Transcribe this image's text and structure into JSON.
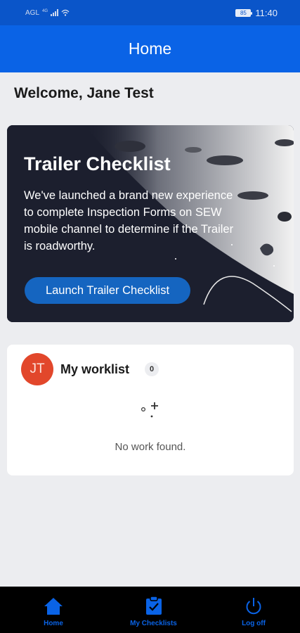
{
  "status_bar": {
    "carrier": "AGL",
    "network": "4G",
    "battery": "85",
    "time": "11:40",
    "icons": [
      "signal-icon",
      "wifi-icon",
      "battery-icon"
    ]
  },
  "app_bar": {
    "title": "Home"
  },
  "welcome": {
    "text": "Welcome, Jane Test"
  },
  "banner": {
    "title": "Trailer Checklist",
    "description": "We've launched a brand new experience to complete Inspection Forms on SEW mobile channel to determine if the Trailer is roadworthy.",
    "button_label": "Launch Trailer Checklist"
  },
  "worklist": {
    "avatar_initials": "JT",
    "title": "My worklist",
    "count": "0",
    "empty_message": "No work found.",
    "empty_icon": "sparkle-icon"
  },
  "bottom_nav": {
    "items": [
      {
        "label": "Home",
        "icon": "home-icon"
      },
      {
        "label": "My Checklists",
        "icon": "clipboard-icon"
      },
      {
        "label": "Log off",
        "icon": "power-icon"
      }
    ]
  },
  "colors": {
    "primary": "#0a63e6",
    "status_bar": "#0a55c9",
    "avatar": "#e2472b",
    "button": "#1565c0",
    "background": "#ecedf0"
  }
}
